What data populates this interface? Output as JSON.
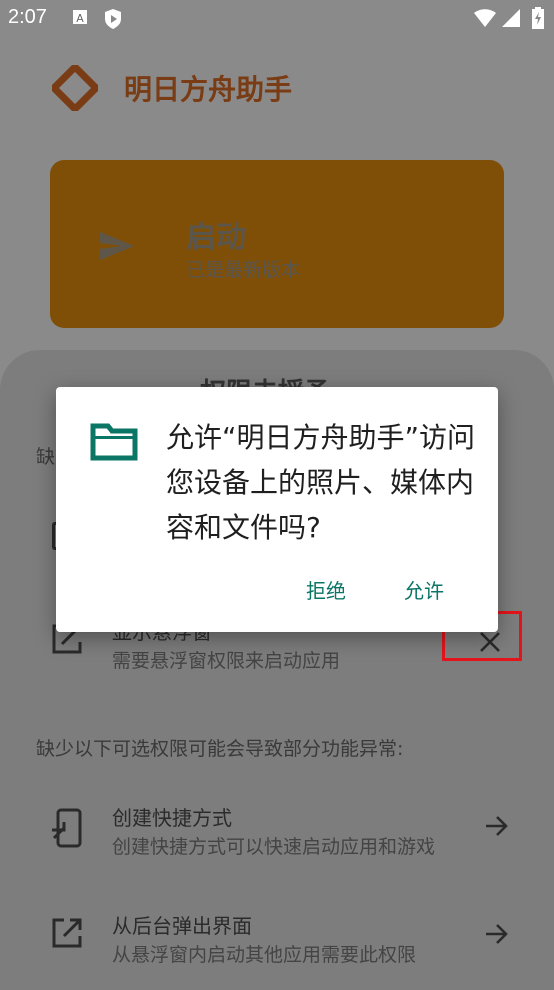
{
  "status_bar": {
    "time": "2:07",
    "icons": [
      "font-a-icon",
      "play-shield-icon",
      "wifi-icon",
      "signal-icon",
      "battery-charging-icon"
    ]
  },
  "app": {
    "title": "明日方舟助手",
    "brand_color": "#c0561f",
    "launch": {
      "label": "启动",
      "subtitle": "已是最新版本",
      "card_color": "#e8900c"
    }
  },
  "sheet": {
    "title": "权限未授予",
    "required_label": "缺",
    "required_items": [
      {
        "title": "显示悬浮窗",
        "subtitle": "需要悬浮窗权限来启动应用",
        "icon": "external-edit-icon",
        "action_icon": "close-icon"
      }
    ],
    "optional_label": "缺少以下可选权限可能会导致部分功能异常:",
    "optional_items": [
      {
        "title": "创建快捷方式",
        "subtitle": "创建快捷方式可以快速启动应用和游戏",
        "icon": "shortcut-phone-icon",
        "action_icon": "arrow-right-icon"
      },
      {
        "title": "从后台弹出界面",
        "subtitle": "从悬浮窗内启动其他应用需要此权限",
        "icon": "open-in-new-icon",
        "action_icon": "arrow-right-icon"
      }
    ]
  },
  "dialog": {
    "icon": "folder-icon",
    "message": "允许“明日方舟助手”访问您设备上的照片、媒体内容和文件吗?",
    "deny_label": "拒绝",
    "allow_label": "允许",
    "accent_color": "#0b7566"
  },
  "highlight_color": "#e5141a"
}
